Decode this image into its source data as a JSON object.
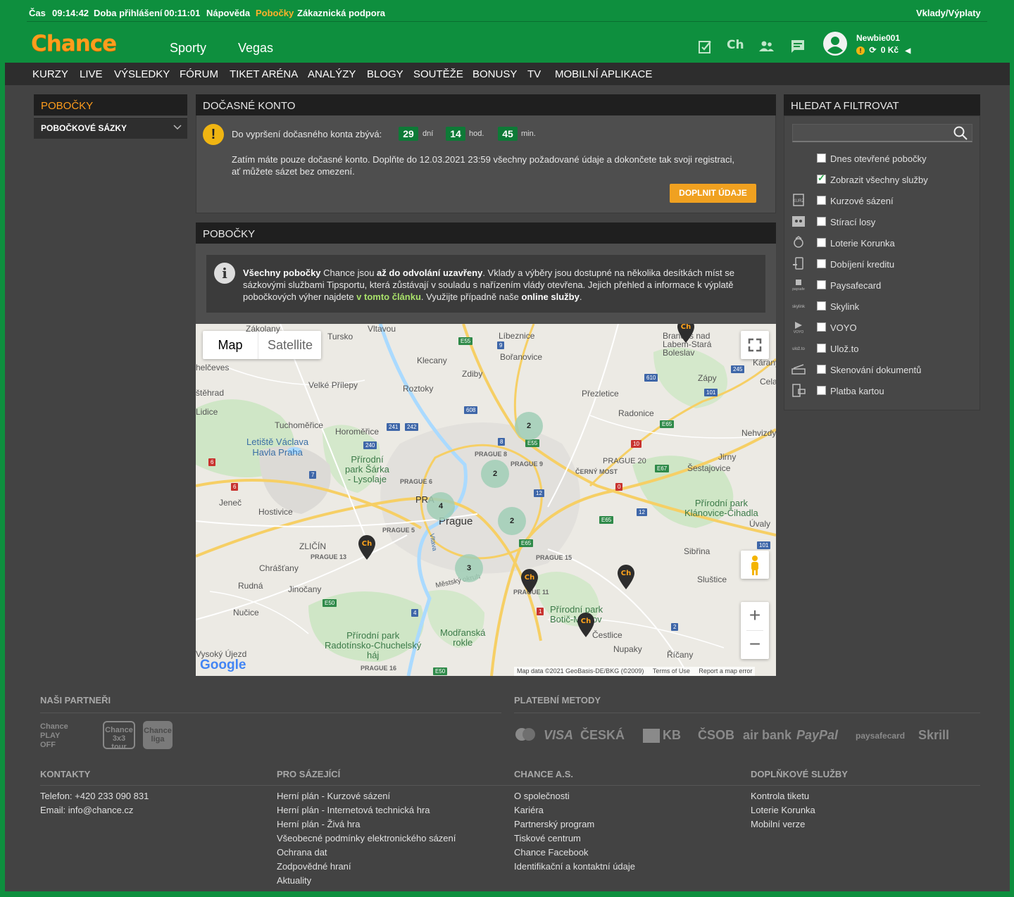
{
  "status_bar": {
    "time_label": "Čas",
    "time_value": "09:14:42",
    "login_label": "Doba přihlášení",
    "login_value": "00:11:01",
    "help": "Nápověda",
    "branches": "Pobočky",
    "support": "Zákaznická podpora",
    "deposits": "Vklady/Výplaty"
  },
  "header": {
    "logo": "Chance",
    "nav": [
      "Sporty",
      "Vegas"
    ],
    "icons": [
      "ticket-check-icon",
      "chance-icon",
      "friends-icon",
      "messages-icon"
    ],
    "username": "Newbie001",
    "balance": "0 Kč"
  },
  "navbar": [
    "KURZY",
    "LIVE",
    "VÝSLEDKY",
    "FÓRUM",
    "TIKET ARÉNA",
    "ANALÝZY",
    "BLOGY",
    "SOUTĚŽE",
    "BONUSY",
    "TV",
    "MOBILNÍ APLIKACE"
  ],
  "left_panel": {
    "title": "POBOČKY",
    "item": "POBOČKOVÉ SÁZKY"
  },
  "temp_account": {
    "title": "DOČASNÉ KONTO",
    "warning": "Do vypršení dočasného konta zbývá:",
    "days": "29",
    "days_unit": "dní",
    "hours": "14",
    "hours_unit": "hod.",
    "minutes": "45",
    "minutes_unit": "min.",
    "text": "Zatím máte pouze dočasné konto. Doplňte do 12.03.2021 23:59 všechny požadované údaje a dokončete tak svoji registraci, ať můžete sázet bez omezení.",
    "button": "DOPLNIT ÚDAJE"
  },
  "branches": {
    "title": "POBOČKY",
    "info_b1": "Všechny pobočky",
    "info_t1": " Chance jsou ",
    "info_b2": "až do odvolání uzavřeny",
    "info_t2": ". Vklady a výběry jsou dostupné na několika desítkách míst se sázkovými službami Tipsportu, která zůstávají v souladu s nařízením vlády otevřena. Jejich přehled a informace k výplatě pobočkových výher najdete ",
    "info_link": "v tomto článku",
    "info_t3": ". Využijte případně naše ",
    "info_b3": "online služby",
    "info_t4": "."
  },
  "map": {
    "type_map": "Map",
    "type_satellite": "Satellite",
    "clusters": [
      "2",
      "2",
      "4",
      "2",
      "3"
    ],
    "pin_label": "Ch",
    "attribution": "Map data ©2021 GeoBasis-DE/BKG (©2009)",
    "terms": "Terms of Use",
    "report": "Report a map error",
    "google": "Google",
    "labels": {
      "zakolany": "Zákolany",
      "vltavou": "Vltavou",
      "libeznice": "Líbeznice",
      "brandys": "Brandýs nad\nLabem-Stará\nBoleslav",
      "turska": "Tursko",
      "helceves": "helčeves",
      "klecany": "Klecany",
      "borovice": "Bořanovice",
      "karany": "Káraný",
      "strad": "štěhrad",
      "zdiby": "Zdiby",
      "velke": "Velké Přílepy",
      "roztoky": "Roztoky",
      "prezletice": "Přezletice",
      "zapy": "Zápy",
      "cela": "Cela",
      "lidice": "Lidice",
      "radonice": "Radonice",
      "tucho": "Tuchoměřice",
      "horo": "Horoměřice",
      "nehvizdy": "Nehvizdy",
      "letiste": "Letiště Václava\nHavla Praha",
      "sarka": "Přírodní\npark Šárka\n- Lysolaje",
      "p8": "PRAGUE 8",
      "p9": "PRAGUE 9",
      "p20": "PRAGUE 20",
      "jirny": "Jirny",
      "cerny": "ČERNÝ MOST",
      "sestajovice": "Šestajovice",
      "p6": "PRAGUE 6",
      "jenec": "Jeneč",
      "hostivice": "Hostivice",
      "pra": "PRA",
      "prague": "Prague",
      "klanovice": "Přírodní park\nKlánovice-Čihadla",
      "uvaly": "Úvaly",
      "p5": "PRAGUE 5",
      "zlicin": "ZLIČÍN",
      "p13": "PRAGUE 13",
      "sibrina": "Sibřina",
      "chrastany": "Chrášťany",
      "p15": "PRAGUE 15",
      "rudna": "Rudná",
      "jinocany": "Jinočany",
      "mestsky": "Městský okruh",
      "p11": "PRAGUE 11",
      "slustice": "Sluštice",
      "nucice": "Nučice",
      "botic": "Přírodní park\nBotič-Milíčov",
      "cestlice": "Čestlice",
      "radotin": "Přírodní park\nRadotínsko-Chuchelský\nháj",
      "modranska": "Modřanská\nrokle",
      "nupaky": "Nupaky",
      "vysoky": "Vysoký Újezd",
      "ricany": "Říčany",
      "p16": "PRAGUE 16",
      "vltava": "Vltava"
    }
  },
  "filter": {
    "title": "HLEDAT A FILTROVAT",
    "items": [
      {
        "label": "Dnes otevřené pobočky",
        "checked": false,
        "icon": ""
      },
      {
        "label": "Zobrazit všechny služby",
        "checked": true,
        "icon": ""
      },
      {
        "label": "Kurzové sázení",
        "checked": false,
        "icon": "kurz-sazeni-icon"
      },
      {
        "label": "Stírací losy",
        "checked": false,
        "icon": "scratch-ticket-icon"
      },
      {
        "label": "Loterie Korunka",
        "checked": false,
        "icon": "korunka-icon"
      },
      {
        "label": "Dobíjení kreditu",
        "checked": false,
        "icon": "phone-credit-icon"
      },
      {
        "label": "Paysafecard",
        "checked": false,
        "icon": "paysafecard-icon"
      },
      {
        "label": "Skylink",
        "checked": false,
        "icon": "skylink-icon"
      },
      {
        "label": "VOYO",
        "checked": false,
        "icon": "voyo-icon"
      },
      {
        "label": "Ulož.to",
        "checked": false,
        "icon": "ulozto-icon"
      },
      {
        "label": "Skenování dokumentů",
        "checked": false,
        "icon": "scanner-icon"
      },
      {
        "label": "Platba kartou",
        "checked": false,
        "icon": "card-terminal-icon"
      }
    ]
  },
  "footer": {
    "partners_title": "NAŠI PARTNEŘI",
    "partners": [
      "Chance PLAY OFF",
      "Chance 3x3 tour",
      "Chance liga"
    ],
    "payments_title": "PLATEBNÍ METODY",
    "payments": [
      "VISA",
      "ČESKÁ",
      "KB",
      "ČSOB",
      "air bank",
      "PayPal",
      "paysafecard",
      "Skrill"
    ],
    "contacts_title": "KONTAKTY",
    "contacts": [
      "Telefon: +420 233 090 831",
      "Email: info@chance.cz"
    ],
    "bettors_title": "PRO SÁZEJÍCÍ",
    "bettors": [
      "Herní plán - Kurzové sázení",
      "Herní plán - Internetová technická hra",
      "Herní plán - Živá hra",
      "Všeobecné podmínky elektronického sázení",
      "Ochrana dat",
      "Zodpovědné hraní",
      "Aktuality"
    ],
    "company_title": "CHANCE A.S.",
    "company": [
      "O společnosti",
      "Kariéra",
      "Partnerský program",
      "Tiskové centrum",
      "Chance Facebook",
      "Identifikační a kontaktní údaje"
    ],
    "extra_title": "DOPLŇKOVÉ SLUŽBY",
    "extra": [
      "Kontrola tiketu",
      "Loterie Korunka",
      "Mobilní verze"
    ]
  },
  "colors": {
    "brand_green": "#0e8f3e",
    "accent_orange": "#ff9d1c",
    "panel_dark": "#1f1f1f",
    "content_bg": "#434343"
  }
}
